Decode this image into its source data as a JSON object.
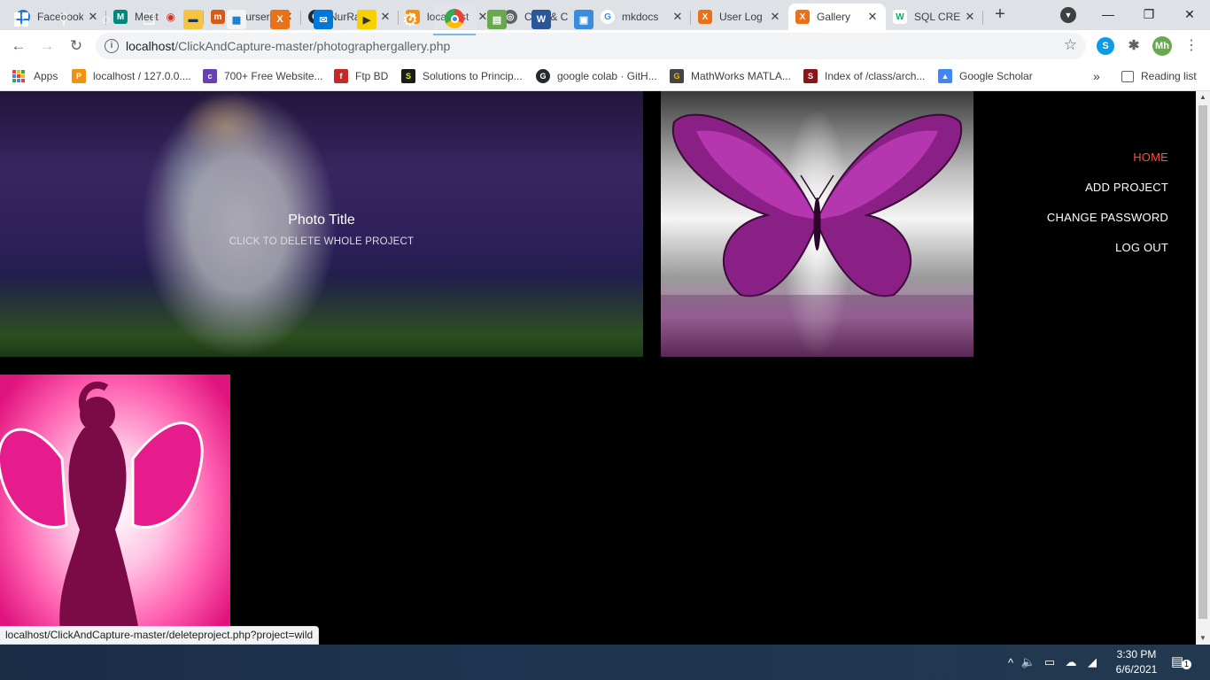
{
  "browser": {
    "tabs": [
      {
        "title": "Facebook",
        "color": "#1877f2",
        "glyph": "f"
      },
      {
        "title": "Meet",
        "color": "#00897b",
        "glyph": "M"
      },
      {
        "title": "Coursera",
        "color": "#d85a17",
        "glyph": "m"
      },
      {
        "title": "NurRafi/",
        "color": "#24292e",
        "glyph": "G"
      },
      {
        "title": "localhost",
        "color": "#f29111",
        "glyph": "P"
      },
      {
        "title": "Click & C",
        "color": "#5f6368",
        "glyph": "@"
      },
      {
        "title": "mkdocs",
        "color": "#4285f4",
        "glyph": "G"
      },
      {
        "title": "User Log",
        "color": "#e8711a",
        "glyph": "X"
      },
      {
        "title": "Gallery",
        "color": "#e8711a",
        "glyph": "X",
        "active": true
      },
      {
        "title": "SQL CRE",
        "color": "#04aa6d",
        "glyph": "W"
      }
    ],
    "url_host": "localhost",
    "url_path": "/ClickAndCapture-master/photographergallery.php",
    "profile_initials": "Mh",
    "bookmarks": [
      {
        "label": "Apps"
      },
      {
        "label": "localhost / 127.0.0....",
        "color": "#f29111",
        "glyph": "P"
      },
      {
        "label": "700+ Free Website...",
        "color": "#6a3fb5",
        "glyph": "c"
      },
      {
        "label": "Ftp BD",
        "color": "#c62828",
        "glyph": "f"
      },
      {
        "label": "Solutions to Princip...",
        "color": "#1b1b1b",
        "glyph": "S"
      },
      {
        "label": "google colab · GitH...",
        "color": "#24292e",
        "glyph": "G"
      },
      {
        "label": "MathWorks MATLA...",
        "color": "#444",
        "glyph": "G"
      },
      {
        "label": "Index of /class/arch...",
        "color": "#8c1515",
        "glyph": "S"
      },
      {
        "label": "Google Scholar",
        "color": "#4285f4",
        "glyph": "▲"
      }
    ],
    "reading_list": "Reading list",
    "more_bookmarks": "»"
  },
  "page": {
    "photo_title": "Photo Title",
    "photo_action": "CLICK TO DELETE WHOLE PROJECT",
    "nav": [
      {
        "label": "HOME",
        "active": true
      },
      {
        "label": "ADD PROJECT"
      },
      {
        "label": "CHANGE PASSWORD"
      },
      {
        "label": "LOG OUT"
      }
    ],
    "status_url": "localhost/ClickAndCapture-master/deleteproject.php?project=wild"
  },
  "taskbar": {
    "time": "3:30 PM",
    "date": "6/6/2021",
    "notifications": "1"
  },
  "colors": {
    "accent_active": "#ff4f3b",
    "page_bg": "#000000"
  }
}
